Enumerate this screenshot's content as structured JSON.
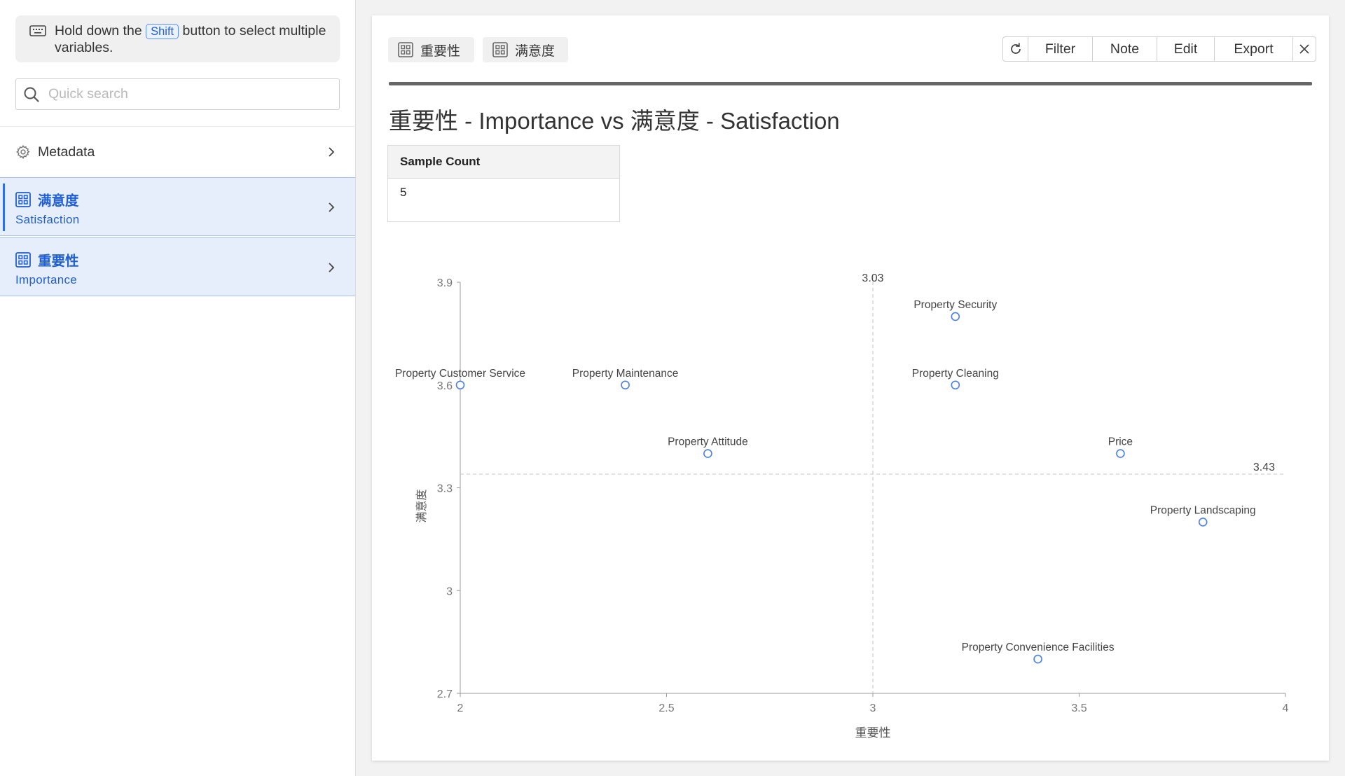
{
  "sidebar": {
    "hint": {
      "prefix": "Hold down the",
      "key": "Shift",
      "suffix": "button to select multiple variables."
    },
    "search": {
      "placeholder": "Quick search",
      "value": ""
    },
    "metadata": {
      "label": "Metadata"
    },
    "variables": [
      {
        "name": "满意度",
        "sub": "Satisfaction",
        "active": true
      },
      {
        "name": "重要性",
        "sub": "Importance",
        "active": false
      }
    ]
  },
  "main": {
    "tabs": [
      {
        "label": "重要性"
      },
      {
        "label": "满意度"
      }
    ],
    "toolbar": {
      "filter": "Filter",
      "note": "Note",
      "edit": "Edit",
      "export": "Export"
    },
    "title": "重要性 - Importance vs 满意度 - Satisfaction",
    "stats": {
      "header": "Sample Count",
      "value": "5"
    }
  },
  "chart_data": {
    "type": "scatter",
    "title": "",
    "xlabel": "重要性",
    "ylabel": "满意度",
    "xlim": [
      2,
      4
    ],
    "ylim": [
      2.7,
      3.9
    ],
    "xticks": [
      "2",
      "2.5",
      "3",
      "3.5",
      "4"
    ],
    "yticks": [
      "2.7",
      "3",
      "3.3",
      "3.6",
      "3.9"
    ],
    "reference_lines": {
      "x": 3.0,
      "x_label": "3.03",
      "y": 3.34,
      "y_label": "3.43"
    },
    "points": [
      {
        "label": "Property Security",
        "x": 3.2,
        "y": 3.8
      },
      {
        "label": "Property Customer Service",
        "x": 2.0,
        "y": 3.6
      },
      {
        "label": "Property Maintenance",
        "x": 2.4,
        "y": 3.6
      },
      {
        "label": "Property Cleaning",
        "x": 3.2,
        "y": 3.6
      },
      {
        "label": "Property Attitude",
        "x": 2.6,
        "y": 3.4
      },
      {
        "label": "Price",
        "x": 3.6,
        "y": 3.4
      },
      {
        "label": "Property Landscaping",
        "x": 3.8,
        "y": 3.2
      },
      {
        "label": "Property Convenience Facilities",
        "x": 3.4,
        "y": 2.8
      }
    ],
    "colors": {
      "point": "#4a7fe8",
      "axis": "#999999",
      "reference": "#cccccc"
    }
  }
}
